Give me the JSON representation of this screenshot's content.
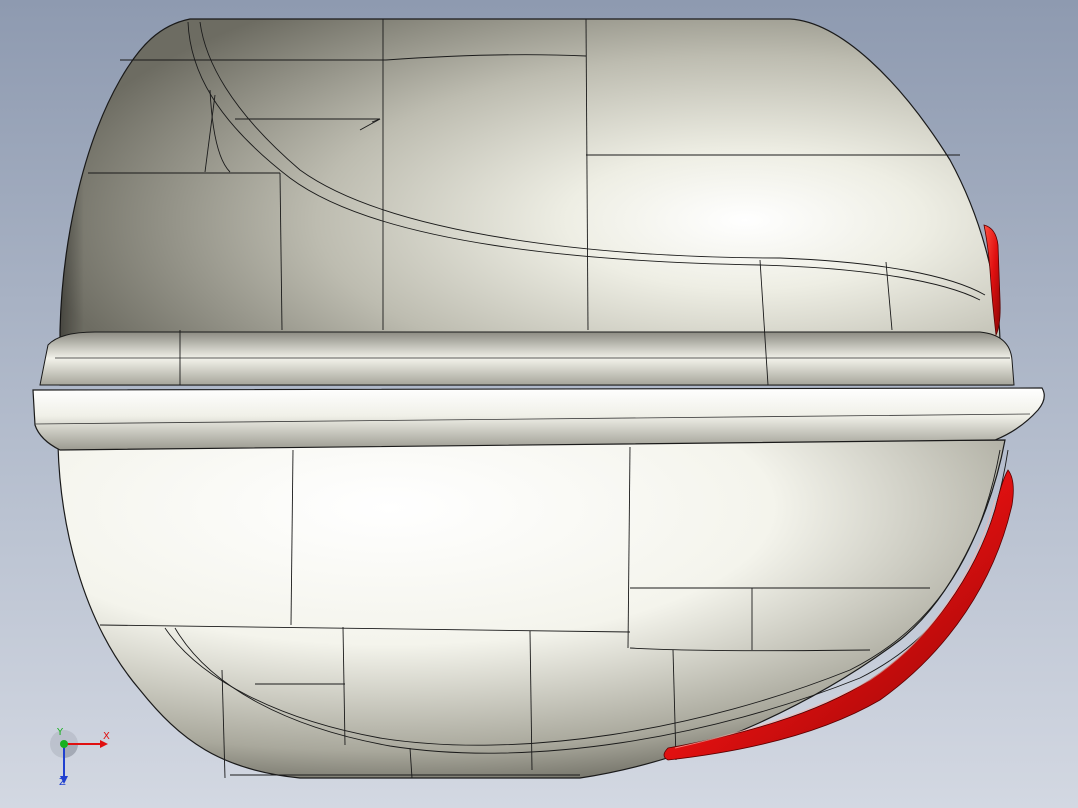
{
  "viewport": {
    "background_top": "#8e9ab0",
    "background_bottom": "#d3d8e2"
  },
  "model": {
    "body_color": "#e6e5da",
    "edge_color": "#1a1a1a",
    "accent_color": "#e01010"
  },
  "triad": {
    "x_label": "X",
    "y_label": "Y",
    "z_label": "Z",
    "x_color": "#e01010",
    "y_color": "#18b020",
    "z_color": "#2040d0"
  }
}
